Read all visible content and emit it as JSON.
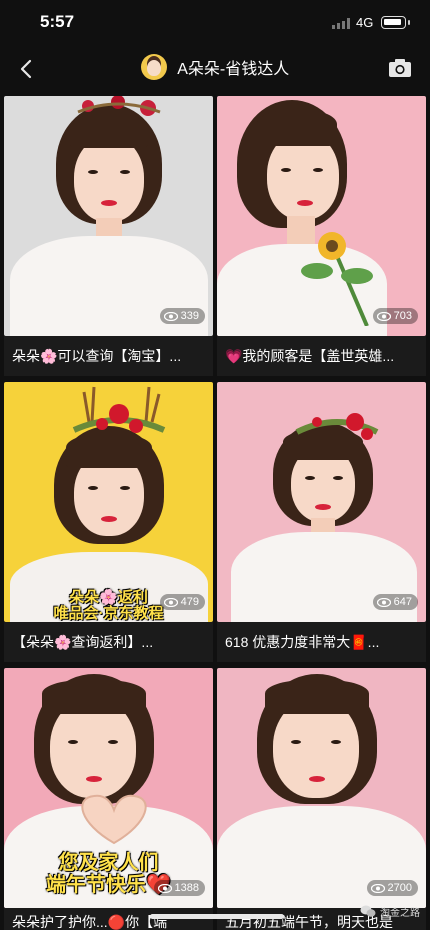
{
  "status": {
    "time": "5:57",
    "network": "4G"
  },
  "header": {
    "title": "A朵朵-省钱达人"
  },
  "icons": {
    "back": "chevron-left-icon",
    "camera": "camera-icon",
    "views": "eye-icon"
  },
  "cards": [
    {
      "caption": "朵朵🌸可以查询【淘宝】...",
      "views": "339",
      "bg": "#dcdcdc",
      "overlay": ""
    },
    {
      "caption": "💗我的顾客是【盖世英雄...",
      "views": "703",
      "bg": "#f4b5c1",
      "overlay": ""
    },
    {
      "caption": "【朵朵🌸查询返利】...",
      "views": "479",
      "bg": "#f6d23a",
      "overlay": "朵朵🌸返利\n唯品会·京东教程"
    },
    {
      "caption": "618 优惠力度非常大🧧...",
      "views": "647",
      "bg": "#f2b9c4",
      "overlay": ""
    },
    {
      "caption": "朵朵护了护你...🔴你【端",
      "views": "1388",
      "bg": "#f2a9b8",
      "overlay": "您及家人们\n端午节快乐❤️"
    },
    {
      "caption": "五月初五端午节，明天也是",
      "views": "2700",
      "bg": "#f0b6c2",
      "overlay": ""
    }
  ],
  "watermark": {
    "text": "淘金之路"
  }
}
